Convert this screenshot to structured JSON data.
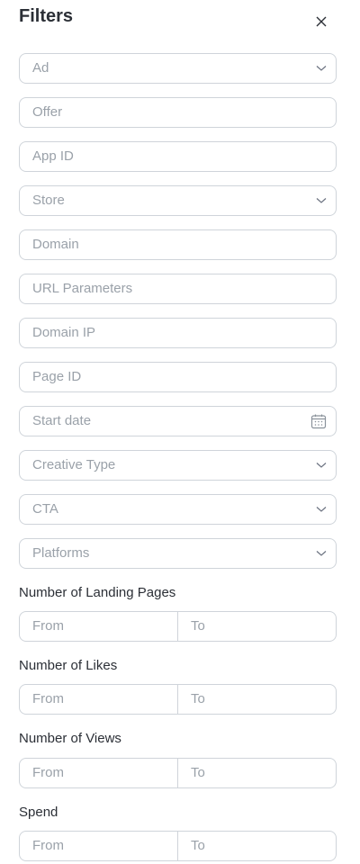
{
  "header": {
    "title": "Filters"
  },
  "fields": {
    "ad": "Ad",
    "offer": "Offer",
    "app_id": "App ID",
    "store": "Store",
    "domain": "Domain",
    "url_parameters": "URL Parameters",
    "domain_ip": "Domain IP",
    "page_id": "Page ID",
    "start_date": "Start date",
    "creative_type": "Creative Type",
    "cta": "CTA",
    "platforms": "Platforms"
  },
  "ranges": {
    "landing_pages": {
      "label": "Number of Landing Pages",
      "from": "From",
      "to": "To"
    },
    "likes": {
      "label": "Number of Likes",
      "from": "From",
      "to": "To"
    },
    "views": {
      "label": "Number of Views",
      "from": "From",
      "to": "To"
    },
    "spend": {
      "label": "Spend",
      "from": "From",
      "to": "To"
    }
  },
  "icons": {
    "close": "close-icon",
    "chevron": "chevron-down-icon",
    "calendar": "calendar-icon"
  },
  "colors": {
    "border": "#cfd4da",
    "placeholder": "#9aa1a9",
    "text": "#2b2f36"
  }
}
